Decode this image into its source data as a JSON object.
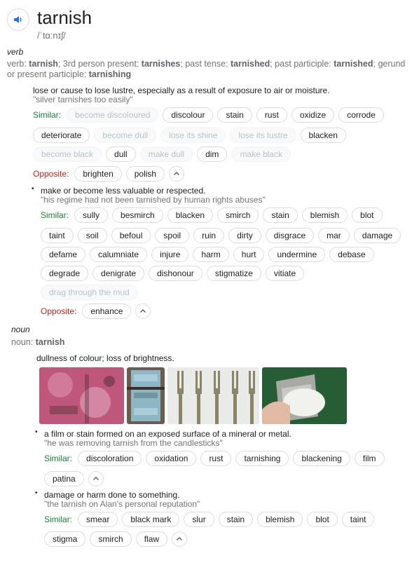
{
  "header": {
    "word": "tarnish",
    "phonetic": "/ˈtɑːnɪʃ/"
  },
  "verb": {
    "pos": "verb",
    "forms": {
      "p1": "verb: ",
      "w1": "tarnish",
      "p2": "; 3rd person present: ",
      "w2": "tarnishes",
      "p3": "; past tense: ",
      "w3": "tarnished",
      "p4": "; past participle: ",
      "w4": "tarnished",
      "p5": "; gerund or present participle: ",
      "w5": "tarnishing"
    },
    "sense1": {
      "def": "lose or cause to lose lustre, especially as a result of exposure to air or moisture.",
      "example": "\"silver tarnishes too easily\"",
      "similar_label": "Similar:",
      "row1": [
        {
          "t": "become discoloured",
          "d": true
        },
        {
          "t": "discolour"
        },
        {
          "t": "stain"
        },
        {
          "t": "rust"
        },
        {
          "t": "oxidize"
        },
        {
          "t": "corrode"
        }
      ],
      "row2": [
        {
          "t": "deteriorate"
        },
        {
          "t": "become dull",
          "d": true
        },
        {
          "t": "lose its shine",
          "d": true
        },
        {
          "t": "lose its lustre",
          "d": true
        },
        {
          "t": "blacken"
        }
      ],
      "row3": [
        {
          "t": "become black",
          "d": true
        },
        {
          "t": "dull"
        },
        {
          "t": "make dull",
          "d": true
        },
        {
          "t": "dim"
        },
        {
          "t": "make black",
          "d": true
        }
      ],
      "opposite_label": "Opposite:",
      "opposite": [
        {
          "t": "brighten"
        },
        {
          "t": "polish"
        }
      ]
    },
    "sense2": {
      "def": "make or become less valuable or respected.",
      "example": "\"his regime had not been tarnished by human rights abuses\"",
      "similar_label": "Similar:",
      "row1": [
        {
          "t": "sully"
        },
        {
          "t": "besmirch"
        },
        {
          "t": "blacken"
        },
        {
          "t": "smirch"
        },
        {
          "t": "stain"
        },
        {
          "t": "blemish"
        },
        {
          "t": "blot"
        }
      ],
      "row2": [
        {
          "t": "taint"
        },
        {
          "t": "soil"
        },
        {
          "t": "befoul"
        },
        {
          "t": "spoil"
        },
        {
          "t": "ruin"
        },
        {
          "t": "dirty"
        },
        {
          "t": "disgrace"
        },
        {
          "t": "mar"
        },
        {
          "t": "damage"
        }
      ],
      "row3": [
        {
          "t": "defame"
        },
        {
          "t": "calumniate"
        },
        {
          "t": "injure"
        },
        {
          "t": "harm"
        },
        {
          "t": "hurt"
        },
        {
          "t": "undermine"
        },
        {
          "t": "debase"
        }
      ],
      "row4": [
        {
          "t": "degrade"
        },
        {
          "t": "denigrate"
        },
        {
          "t": "dishonour"
        },
        {
          "t": "stigmatize"
        },
        {
          "t": "vitiate"
        }
      ],
      "row5": [
        {
          "t": "drag through the mud",
          "d": true
        }
      ],
      "opposite_label": "Opposite:",
      "opposite": [
        {
          "t": "enhance"
        }
      ]
    }
  },
  "noun": {
    "pos": "noun",
    "forms": {
      "p1": "noun: ",
      "w1": "tarnish"
    },
    "sense1": {
      "def": "dullness of colour; loss of brightness."
    },
    "images": [
      "rusted-pink-metal",
      "weathered-blue-metal",
      "tarnished-forks",
      "polishing-silver-cup"
    ],
    "sense2": {
      "def": "a film or stain formed on an exposed surface of a mineral or metal.",
      "example": "\"he was removing tarnish from the candlesticks\"",
      "similar_label": "Similar:",
      "row1": [
        {
          "t": "discoloration"
        },
        {
          "t": "oxidation"
        },
        {
          "t": "rust"
        },
        {
          "t": "tarnishing"
        },
        {
          "t": "blackening"
        },
        {
          "t": "film"
        }
      ],
      "row2": [
        {
          "t": "patina"
        }
      ]
    },
    "sense3": {
      "def": "damage or harm done to something.",
      "example": "\"the tarnish on Alan's personal reputation\"",
      "similar_label": "Similar:",
      "row1": [
        {
          "t": "smear"
        },
        {
          "t": "black mark"
        },
        {
          "t": "slur"
        },
        {
          "t": "stain"
        },
        {
          "t": "blemish"
        },
        {
          "t": "blot"
        },
        {
          "t": "taint"
        }
      ],
      "row2": [
        {
          "t": "stigma"
        },
        {
          "t": "smirch"
        },
        {
          "t": "flaw"
        }
      ]
    }
  }
}
